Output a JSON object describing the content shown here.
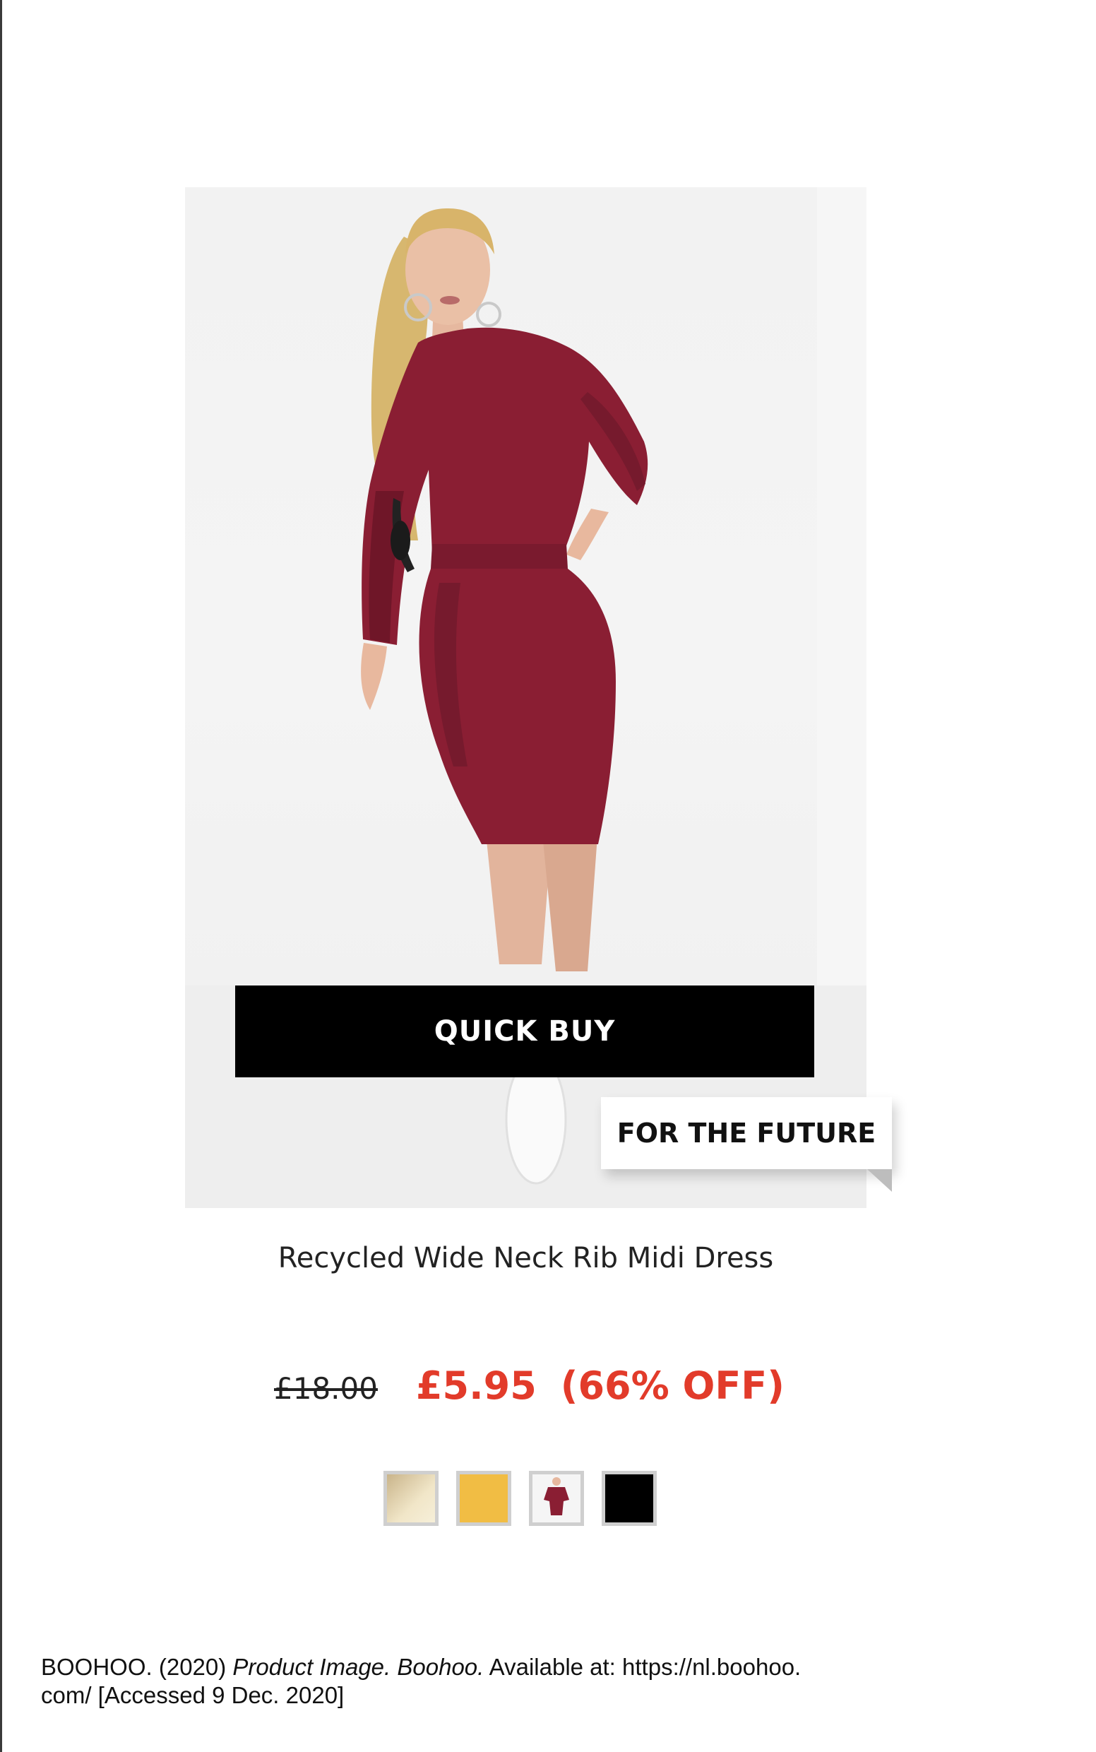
{
  "product": {
    "quick_buy_label": "QUICK BUY",
    "badge_label": "FOR THE FUTURE",
    "title": "Recycled Wide Neck Rib Midi Dress",
    "original_price": "£18.00",
    "sale_price": "£5.95",
    "discount": "(66% OFF)",
    "colors": {
      "accent_sale": "#e23b2a",
      "dress": "#8a1e33",
      "button_bg": "#000000"
    },
    "swatches": [
      {
        "name": "cream",
        "color": "#e8d9b0"
      },
      {
        "name": "yellow",
        "color": "#f1bd44"
      },
      {
        "name": "berry",
        "color": "#8a1e33"
      },
      {
        "name": "black",
        "color": "#000000"
      }
    ]
  },
  "citation": {
    "part1": "BOOHOO. (2020) ",
    "italic": "Product Image. Boohoo.",
    "part2": " Available at: https://nl.boohoo.",
    "line2": "com/ [Accessed 9 Dec. 2020]"
  }
}
